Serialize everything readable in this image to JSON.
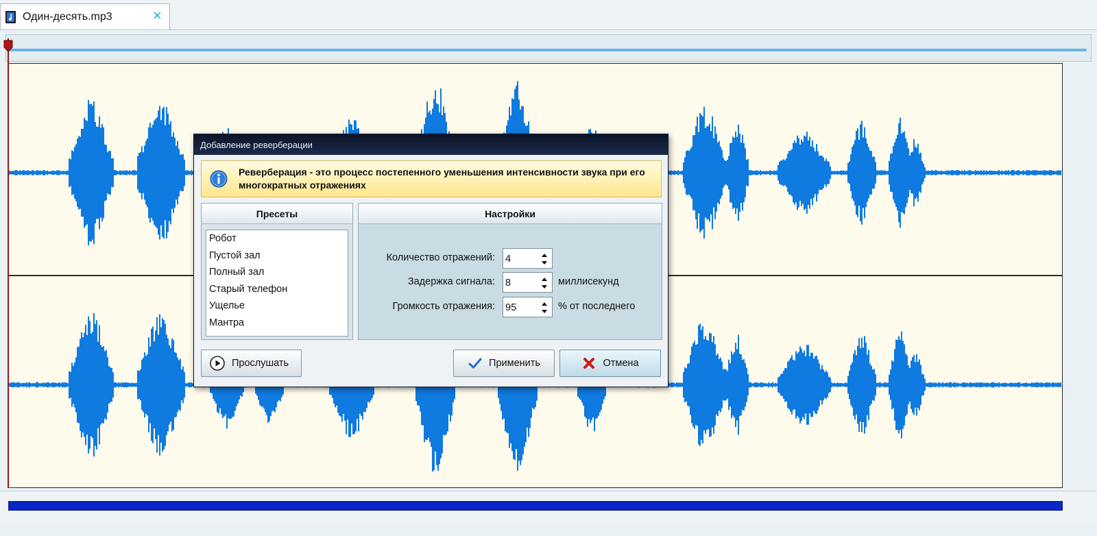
{
  "tab": {
    "title": "Один-десять.mp3",
    "close_glyph": "×",
    "icon": "audio-file-icon"
  },
  "colors": {
    "waveform": "#0f7ae0",
    "wave_background": "#fffbec",
    "playhead": "#9a1616",
    "scrollbar": "#0a25c6"
  },
  "dialog": {
    "title": "Добавление реверберации",
    "info_text": "Реверберация - это процесс постепенного уменьшения интенсивности звука при его многократных отражениях",
    "presets": {
      "header": "Пресеты",
      "items": [
        "Робот",
        "Пустой зал",
        "Полный зал",
        "Старый телефон",
        "Ущелье",
        "Мантра"
      ]
    },
    "settings": {
      "header": "Настройки",
      "reflections": {
        "label": "Количество отражений:",
        "value": "4"
      },
      "delay": {
        "label": "Задержка сигнала:",
        "value": "8",
        "unit": "миллисекунд"
      },
      "volume": {
        "label": "Громкость отражения:",
        "value": "95",
        "unit": "% от последнего"
      }
    },
    "buttons": {
      "listen": "Прослушать",
      "apply": "Применить",
      "cancel": "Отмена"
    }
  }
}
